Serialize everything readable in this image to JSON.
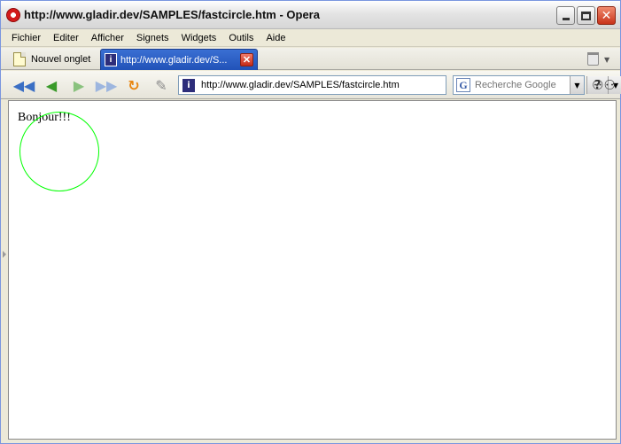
{
  "window": {
    "title": "http://www.gladir.dev/SAMPLES/fastcircle.htm - Opera",
    "close_glyph": "✕"
  },
  "menu": {
    "items": [
      "Fichier",
      "Editer",
      "Afficher",
      "Signets",
      "Widgets",
      "Outils",
      "Aide"
    ]
  },
  "tabs": {
    "new_tab_label": "Nouvel onglet",
    "active_tab_label": "http://www.gladir.dev/S...",
    "close_glyph": "✕"
  },
  "toolbar": {
    "rewind_glyph": "◀◀",
    "back_glyph": "◀",
    "forward_glyph": "▶",
    "ffwd_glyph": "▶▶",
    "reload_glyph": "↻",
    "edit_glyph": "✎",
    "address_value": "http://www.gladir.dev/SAMPLES/fastcircle.htm",
    "help_glyph": "?",
    "dropdown_glyph": "▼",
    "search_engine_glyph": "G",
    "search_placeholder": "Recherche Google",
    "glasses_glyph": "⚇⚇"
  },
  "page": {
    "text": "Bonjour!!!",
    "circle_color": "#00ff00"
  },
  "icons": {
    "app": "opera-icon",
    "tab_page": "new-page-icon",
    "favicon": "site-favicon-icon",
    "trash": "trash-icon",
    "search_engine": "google-icon",
    "zoom": "glasses-icon"
  }
}
